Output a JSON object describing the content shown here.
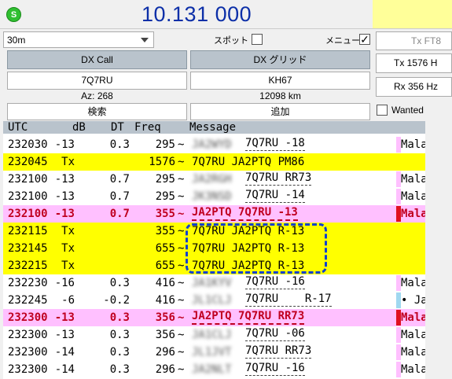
{
  "header": {
    "status_icon_letter": "S",
    "dial_frequency": "10.131 000",
    "band": "30m",
    "spot_label": "スポット",
    "menu_label": "メニュー",
    "menu_checked": "✓",
    "tx_mode_button": "Tx FT8",
    "tx_freq_label": "Tx  1576  H",
    "rx_freq_label": "Rx  356  Hz",
    "wanted_label": "Wanted"
  },
  "dx": {
    "call_header": "DX Call",
    "grid_header": "DX グリッド",
    "call_value": "7Q7RU",
    "grid_value": "KH67",
    "azimuth": "Az: 268",
    "distance": "12098 km",
    "search_button": "検索",
    "add_button": "追加"
  },
  "table": {
    "columns": [
      "UTC",
      "dB",
      "DT",
      "Freq",
      "Message"
    ],
    "rows": [
      {
        "utc": "232030",
        "db": "-13",
        "dt": "0.3",
        "freq": "295",
        "sep": "~",
        "msg": "7Q7RU -18",
        "blur": "JA2WYD",
        "country": "Malawi",
        "style": "white",
        "bar": "#ffc0ff"
      },
      {
        "utc": "232045",
        "db": "Tx",
        "dt": "",
        "freq": "1576",
        "sep": "~",
        "msg": "7Q7RU JA2PTQ PM86",
        "blur": "",
        "country": "",
        "style": "yellow",
        "bar": ""
      },
      {
        "utc": "232100",
        "db": "-13",
        "dt": "0.7",
        "freq": "295",
        "sep": "~",
        "msg": "7Q7RU RR73",
        "blur": "JA2RGH",
        "country": "Malawi",
        "style": "white",
        "bar": "#ffc0ff"
      },
      {
        "utc": "232100",
        "db": "-13",
        "dt": "0.7",
        "freq": "295",
        "sep": "~",
        "msg": "7Q7RU -14",
        "blur": "JK3NSD",
        "country": "Malawi",
        "style": "white",
        "bar": "#ffc0ff"
      },
      {
        "utc": "232100",
        "db": "-13",
        "dt": "0.7",
        "freq": "355",
        "sep": "~",
        "msg": "JA2PTQ 7Q7RU -13",
        "blur": "",
        "country": "Malawi",
        "style": "pink",
        "bar": "#e01020"
      },
      {
        "utc": "232115",
        "db": "Tx",
        "dt": "",
        "freq": "355",
        "sep": "~",
        "msg": "7Q7RU JA2PTQ R-13",
        "blur": "",
        "country": "",
        "style": "yellow",
        "bar": ""
      },
      {
        "utc": "232145",
        "db": "Tx",
        "dt": "",
        "freq": "655",
        "sep": "~",
        "msg": "7Q7RU JA2PTQ R-13",
        "blur": "",
        "country": "",
        "style": "yellow",
        "bar": ""
      },
      {
        "utc": "232215",
        "db": "Tx",
        "dt": "",
        "freq": "655",
        "sep": "~",
        "msg": "7Q7RU JA2PTQ R-13",
        "blur": "",
        "country": "",
        "style": "yellow",
        "bar": ""
      },
      {
        "utc": "232230",
        "db": "-16",
        "dt": "0.3",
        "freq": "416",
        "sep": "~",
        "msg": "7Q7RU -16",
        "blur": "JA1KYV",
        "country": "Malawi",
        "style": "white",
        "bar": "#ffc0ff"
      },
      {
        "utc": "232245",
        "db": "-6",
        "dt": "-0.2",
        "freq": "416",
        "sep": "~",
        "msg": "7Q7RU    R-17",
        "blur": "JL1CLJ",
        "country": "• Japan",
        "style": "white",
        "bar": "#a0d8f0"
      },
      {
        "utc": "232300",
        "db": "-13",
        "dt": "0.3",
        "freq": "356",
        "sep": "~",
        "msg": "JA2PTQ 7Q7RU RR73",
        "blur": "",
        "country": "Malawi",
        "style": "pink",
        "bar": "#e01020"
      },
      {
        "utc": "232300",
        "db": "-13",
        "dt": "0.3",
        "freq": "356",
        "sep": "~",
        "msg": "7Q7RU -06",
        "blur": "JA1CLJ",
        "country": "Malawi",
        "style": "white",
        "bar": "#ffc0ff"
      },
      {
        "utc": "232300",
        "db": "-14",
        "dt": "0.3",
        "freq": "296",
        "sep": "~",
        "msg": "7Q7RU RR73",
        "blur": "JL1JVT",
        "country": "Malawi",
        "style": "white",
        "bar": "#ffc0ff"
      },
      {
        "utc": "232300",
        "db": "-14",
        "dt": "0.3",
        "freq": "296",
        "sep": "~",
        "msg": "7Q7RU -16",
        "blur": "JA2NLT",
        "country": "Malawi",
        "style": "white",
        "bar": "#ffc0ff"
      }
    ]
  },
  "colors": {
    "tx_row": "#ffff00",
    "my_call_row": "#ffc0ff",
    "highlight_box": "#1040d0",
    "frequency_text": "#0c2fa8"
  }
}
